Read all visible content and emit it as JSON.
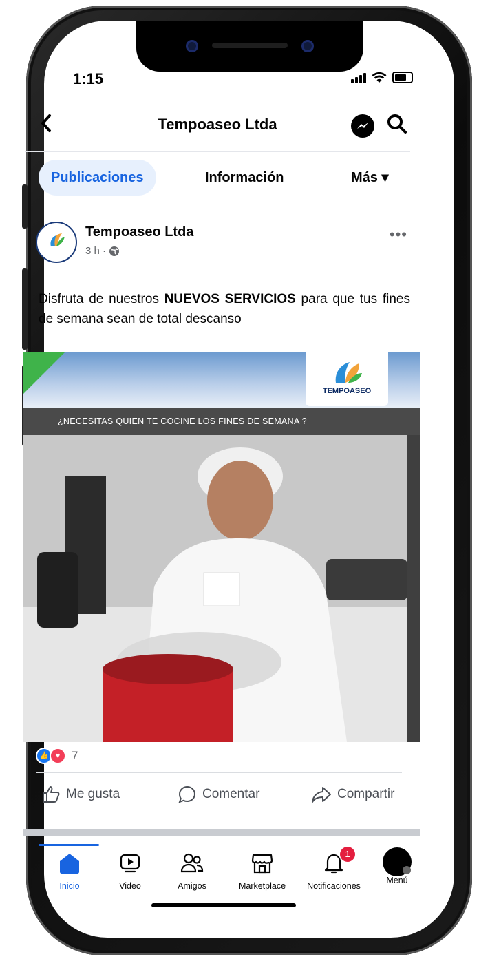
{
  "status": {
    "time": "1:15"
  },
  "topbar": {
    "title": "Tempoaseo Ltda"
  },
  "tabs": [
    "Publicaciones",
    "Información",
    "Más ▾"
  ],
  "post": {
    "author": "Tempoaseo Ltda",
    "meta": "3 h ·",
    "text_before": "Disfruta de nuestros ",
    "text_bold": "NUEVOS SERVICIOS",
    "text_after": " para que tus fines de semana sean de total descanso",
    "image_logo_text": "TEMPOASEO",
    "image_banner": "¿NECESITAS QUIEN TE COCINE LOS FINES DE SEMANA ?",
    "reaction_count": "7",
    "actions": {
      "like": "Me gusta",
      "comment": "Comentar",
      "share": "Compartir"
    }
  },
  "nav": {
    "items": [
      "Inicio",
      "Video",
      "Amigos",
      "Marketplace",
      "Notificaciones",
      "Menú"
    ],
    "badge": "1"
  },
  "colors": {
    "accent": "#1864e0",
    "badge": "#e41e3f",
    "active_tab_bg": "#e7f0fd"
  }
}
